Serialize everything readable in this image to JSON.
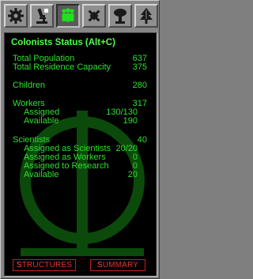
{
  "tabs": [
    {
      "name": "tab-settings",
      "icon": "gear-icon"
    },
    {
      "name": "tab-labs",
      "icon": "microscope-icon"
    },
    {
      "name": "tab-colonists",
      "icon": "colonist-icon"
    },
    {
      "name": "tab-satellites",
      "icon": "satellite-icon"
    },
    {
      "name": "tab-mining",
      "icon": "mushroom-cloud-icon"
    },
    {
      "name": "tab-agriculture",
      "icon": "tree-icon"
    }
  ],
  "panel": {
    "title": "Colonists Status (Alt+C)",
    "total_population": {
      "label": "Total Population",
      "value": "637"
    },
    "total_residence": {
      "label": "Total Residence Capacity",
      "value": "375"
    },
    "children": {
      "label": "Children",
      "value": "280"
    },
    "workers": {
      "label": "Workers",
      "value": "317"
    },
    "workers_assigned": {
      "label": "Assigned",
      "value": "130/130"
    },
    "workers_available": {
      "label": "Available",
      "value": "190"
    },
    "scientists": {
      "label": "Scientists",
      "value": "40"
    },
    "sci_as_scientists": {
      "label": "Assigned as Scientists",
      "value": "20/20"
    },
    "sci_as_workers": {
      "label": "Assigned as Workers",
      "value": "0"
    },
    "sci_to_research": {
      "label": "Assigned to Research",
      "value": "0"
    },
    "sci_available": {
      "label": "Available",
      "value": "20"
    }
  },
  "buttons": {
    "structures": {
      "hot": "S",
      "rest": "TRUCTURES"
    },
    "summary": {
      "hot": "S",
      "rest": "UMMARY"
    }
  },
  "colors": {
    "text": "#2ee02e",
    "title": "#4cff4c",
    "button_text": "#e03535",
    "watermark": "#0b4a0b"
  }
}
